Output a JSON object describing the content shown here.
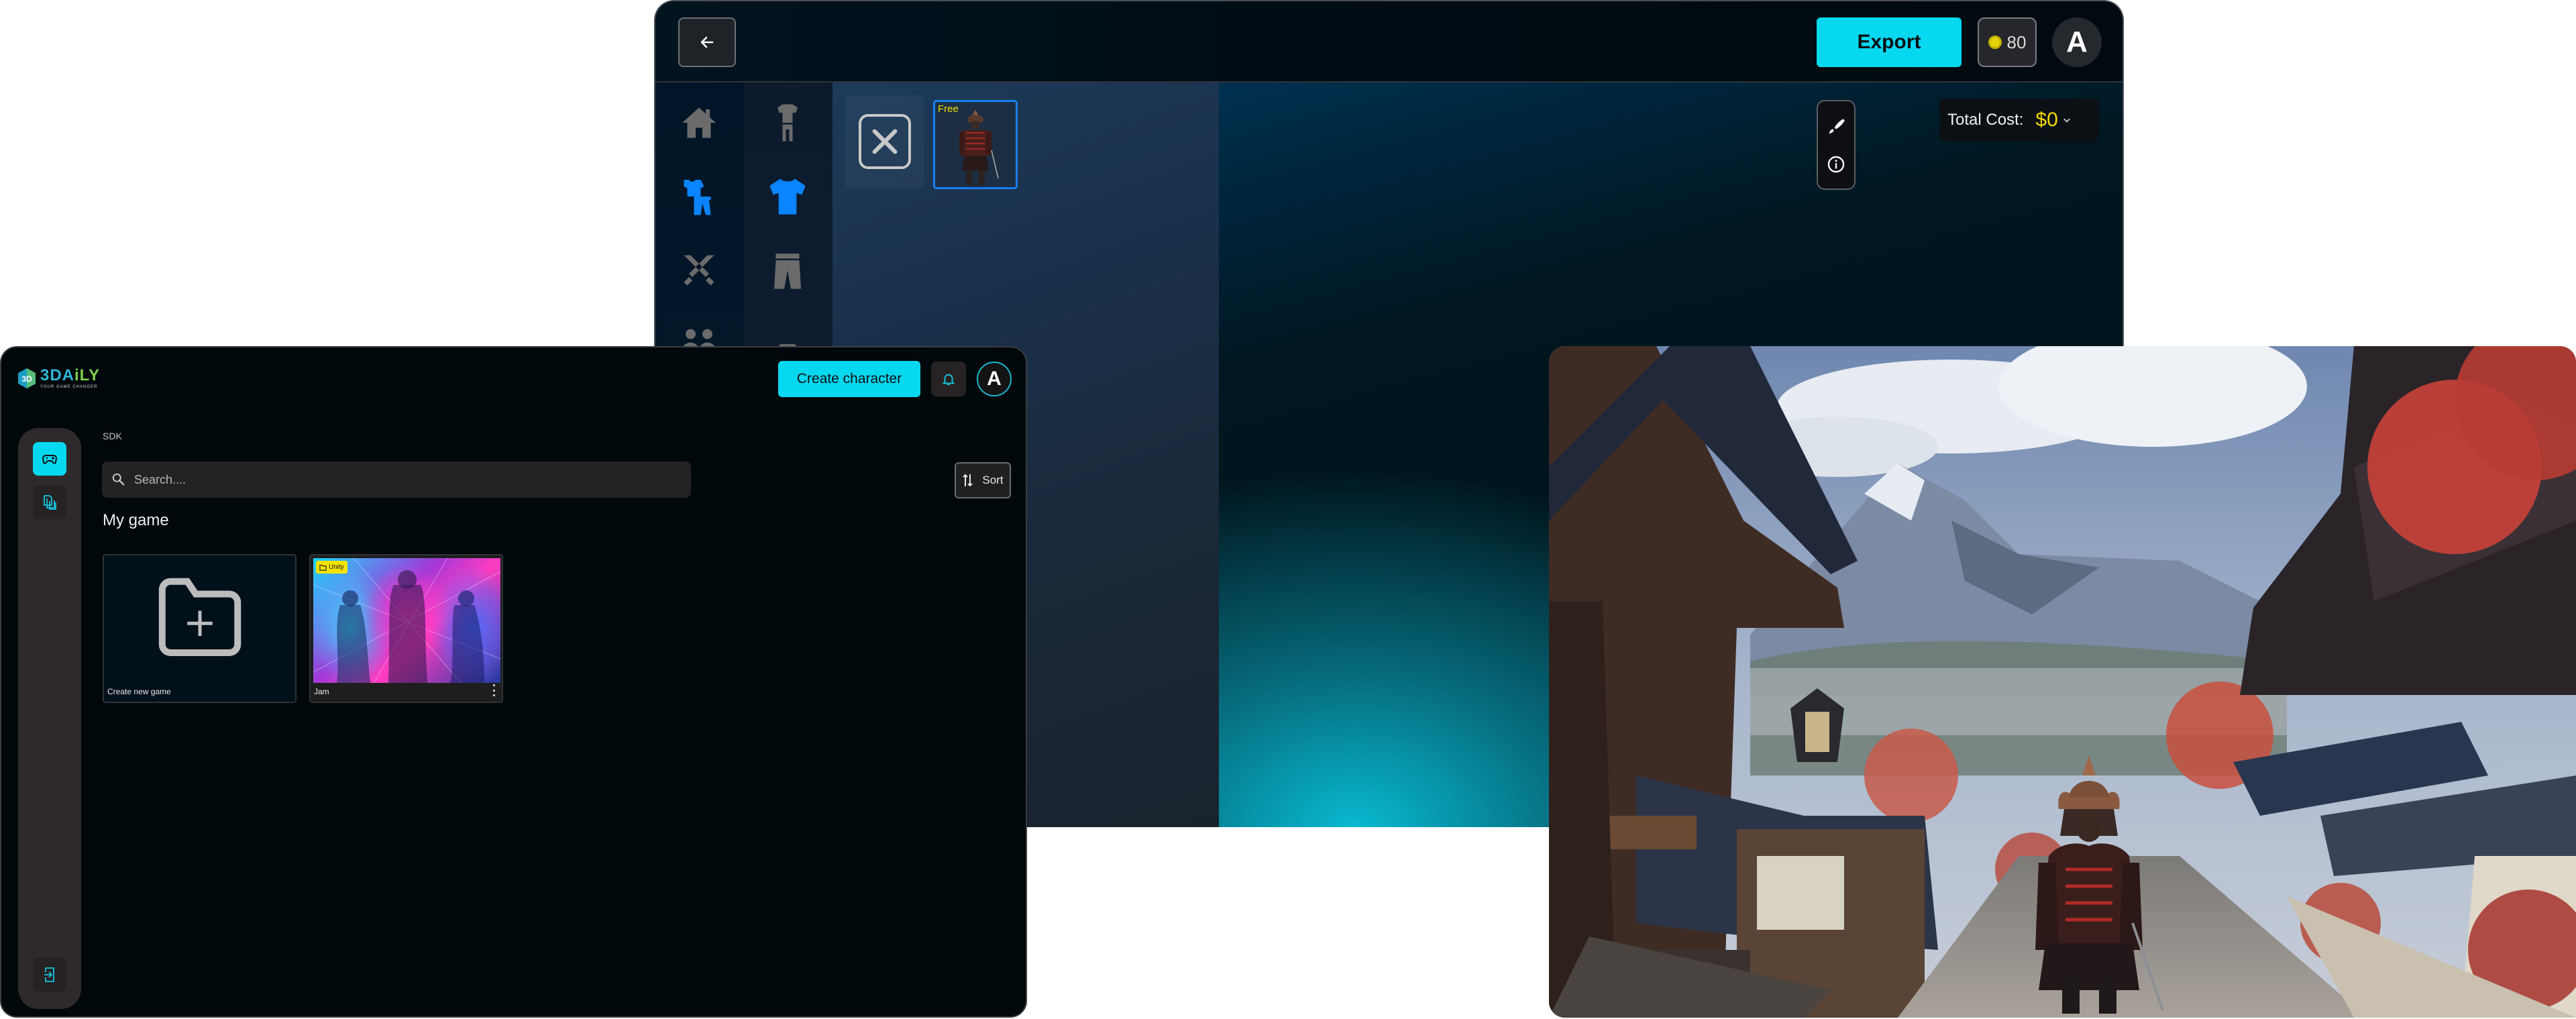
{
  "editor": {
    "header": {
      "back_label": "Back",
      "export_label": "Export",
      "coins": "80",
      "avatar_initial": "A"
    },
    "categories_primary": [
      {
        "icon": "home-icon",
        "label": "Home",
        "active": false
      },
      {
        "icon": "outfit-icon",
        "label": "Outfit",
        "active": true
      },
      {
        "icon": "weapons-icon",
        "label": "Weapons",
        "active": false
      },
      {
        "icon": "characters-icon",
        "label": "Characters",
        "active": false
      }
    ],
    "categories_secondary": [
      {
        "icon": "full-outfit-icon",
        "label": "Full outfit",
        "active": false
      },
      {
        "icon": "shirt-icon",
        "label": "Top",
        "active": true
      },
      {
        "icon": "pants-icon",
        "label": "Bottom",
        "active": false
      },
      {
        "icon": "shoes-icon",
        "label": "Shoes",
        "active": false
      }
    ],
    "items": [
      {
        "type": "none",
        "label": "None"
      },
      {
        "type": "outfit",
        "label": "Samurai armor",
        "price_badge": "Free",
        "selected": true
      }
    ],
    "tools": [
      {
        "icon": "brush-icon",
        "label": "Paint"
      },
      {
        "icon": "info-icon",
        "label": "Info"
      }
    ],
    "total_cost": {
      "label": "Total Cost:",
      "value": "$0"
    },
    "colors": {
      "accent": "#06d8ef",
      "selected": "#1a7ef0",
      "price": "#f2d800"
    }
  },
  "dashboard": {
    "logo": {
      "brand_main": "3DA",
      "brand_accent": "iLY",
      "tagline": "YOUR GAME CHANGER"
    },
    "header": {
      "create_label": "Create character",
      "avatar_initial": "A"
    },
    "sidebar": {
      "items": [
        {
          "icon": "gamepad-icon",
          "label": "Games",
          "active": true
        },
        {
          "icon": "documents-icon",
          "label": "Docs",
          "active": false
        }
      ],
      "footer": {
        "icon": "logout-icon",
        "label": "Log out"
      }
    },
    "breadcrumb": "SDK",
    "search": {
      "placeholder": "Search....",
      "value": ""
    },
    "sort_label": "Sort",
    "section_title": "My game",
    "games": [
      {
        "name": "Create new game",
        "type": "create"
      },
      {
        "name": "Jam",
        "engine": "Unity",
        "type": "game"
      }
    ]
  },
  "scene": {
    "description": "Samurai character in Japanese village with mountains"
  }
}
